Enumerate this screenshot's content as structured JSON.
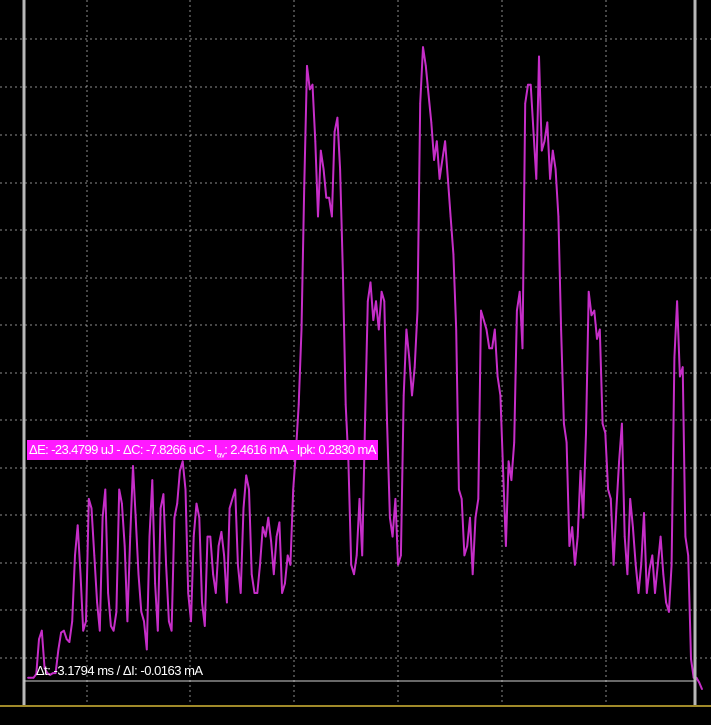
{
  "colors": {
    "background": "#000000",
    "grid": "#ffffff",
    "trace": "#c62ec8",
    "cursor": "#b8b8b8",
    "annotation_bg": "#ff19ff",
    "baseline": "#a08a2a"
  },
  "annotations": {
    "energy_charge": {
      "part1": "ΔE: -23.4799 uJ - ΔC: -7.8266 uC - I",
      "sub": "av",
      "part2": ": 2.4616 mA - Ipk: 0.2830 mA"
    },
    "delta_time_current": "Δt: -3.1794 ms / ΔI: -0.0163 mA"
  },
  "chart_data": {
    "type": "line",
    "series": [
      {
        "values": [
          0.03,
          0.03,
          0.03,
          0.034,
          0.071,
          0.08,
          0.04,
          0.035,
          0.033,
          0.035,
          0.035,
          0.06,
          0.078,
          0.08,
          0.071,
          0.068,
          0.09,
          0.16,
          0.192,
          0.14,
          0.08,
          0.09,
          0.22,
          0.21,
          0.16,
          0.11,
          0.08,
          0.2,
          0.23,
          0.12,
          0.085,
          0.08,
          0.1,
          0.23,
          0.215,
          0.17,
          0.09,
          0.18,
          0.255,
          0.2,
          0.14,
          0.1,
          0.09,
          0.06,
          0.18,
          0.24,
          0.13,
          0.08,
          0.21,
          0.225,
          0.15,
          0.09,
          0.08,
          0.2,
          0.215,
          0.25,
          0.26,
          0.23,
          0.12,
          0.09,
          0.18,
          0.215,
          0.2,
          0.11,
          0.085,
          0.18,
          0.18,
          0.14,
          0.12,
          0.17,
          0.185,
          0.16,
          0.11,
          0.21,
          0.22,
          0.23,
          0.15,
          0.12,
          0.21,
          0.245,
          0.23,
          0.14,
          0.12,
          0.12,
          0.15,
          0.19,
          0.18,
          0.2,
          0.175,
          0.14,
          0.18,
          0.195,
          0.12,
          0.13,
          0.16,
          0.15,
          0.23,
          0.27,
          0.32,
          0.4,
          0.55,
          0.68,
          0.655,
          0.66,
          0.6,
          0.52,
          0.59,
          0.57,
          0.54,
          0.54,
          0.52,
          0.61,
          0.625,
          0.57,
          0.46,
          0.32,
          0.26,
          0.15,
          0.14,
          0.16,
          0.22,
          0.16,
          0.3,
          0.43,
          0.45,
          0.41,
          0.43,
          0.4,
          0.44,
          0.43,
          0.3,
          0.2,
          0.18,
          0.22,
          0.15,
          0.16,
          0.33,
          0.4,
          0.37,
          0.33,
          0.36,
          0.42,
          0.64,
          0.7,
          0.68,
          0.65,
          0.62,
          0.58,
          0.6,
          0.56,
          0.58,
          0.6,
          0.56,
          0.52,
          0.48,
          0.4,
          0.23,
          0.22,
          0.16,
          0.17,
          0.2,
          0.14,
          0.2,
          0.22,
          0.42,
          0.41,
          0.4,
          0.38,
          0.38,
          0.4,
          0.35,
          0.33,
          0.25,
          0.17,
          0.26,
          0.24,
          0.28,
          0.42,
          0.44,
          0.38,
          0.64,
          0.66,
          0.66,
          0.61,
          0.56,
          0.69,
          0.59,
          0.6,
          0.62,
          0.56,
          0.59,
          0.57,
          0.52,
          0.4,
          0.3,
          0.28,
          0.17,
          0.19,
          0.15,
          0.18,
          0.25,
          0.2,
          0.29,
          0.44,
          0.415,
          0.42,
          0.39,
          0.4,
          0.3,
          0.29,
          0.23,
          0.22,
          0.15,
          0.21,
          0.26,
          0.3,
          0.18,
          0.14,
          0.22,
          0.19,
          0.15,
          0.12,
          0.15,
          0.205,
          0.12,
          0.145,
          0.16,
          0.12,
          0.15,
          0.18,
          0.14,
          0.11,
          0.1,
          0.15,
          0.37,
          0.43,
          0.35,
          0.36,
          0.18,
          0.16,
          0.05,
          0.03,
          0.03,
          0.025,
          0.018
        ]
      }
    ]
  }
}
